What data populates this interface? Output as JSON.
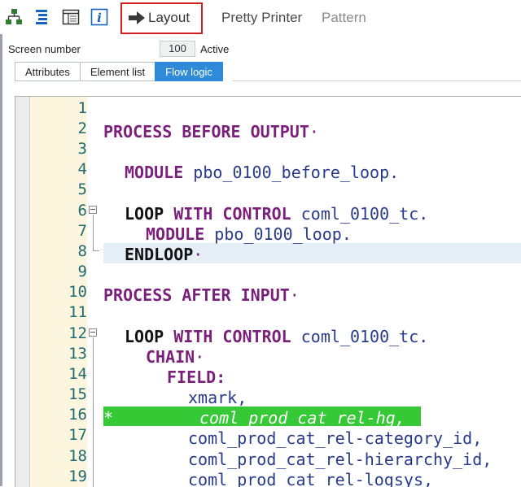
{
  "toolbar": {
    "icons": [
      {
        "name": "hierarchy-icon",
        "color": "#2e7d32"
      },
      {
        "name": "outline-icon",
        "color": "#1565c0"
      },
      {
        "name": "display-list-icon",
        "color": "#333333"
      },
      {
        "name": "info-icon",
        "color": "#1565c0"
      }
    ],
    "layout_label": "Layout",
    "pretty_printer_label": "Pretty Printer",
    "pattern_label": "Pattern"
  },
  "screen": {
    "label": "Screen number",
    "number": "100",
    "status": "Active"
  },
  "tabs": [
    {
      "label": "Attributes",
      "active": false
    },
    {
      "label": "Element list",
      "active": false
    },
    {
      "label": "Flow logic",
      "active": true
    }
  ],
  "editor": {
    "line_numbers": [
      "1",
      "2",
      "3",
      "4",
      "5",
      "6",
      "7",
      "8",
      "9",
      "10",
      "11",
      "12",
      "13",
      "14",
      "15",
      "16",
      "17",
      "18",
      "19"
    ],
    "lines": {
      "l2_kw": "PROCESS BEFORE OUTPUT",
      "l4_kw": "MODULE",
      "l4_id": "pbo_0100_before_loop.",
      "l6_kw1": "LOOP",
      "l6_kw2": "WITH CONTROL",
      "l6_id": "coml_0100_tc.",
      "l7_kw": "MODULE",
      "l7_id": "pbo_0100_loop.",
      "l8_kw": "ENDLOOP",
      "l10_kw": "PROCESS AFTER INPUT",
      "l12_kw1": "LOOP",
      "l12_kw2": "WITH CONTROL",
      "l12_id": "coml_0100_tc.",
      "l13_kw": "CHAIN",
      "l14_kw": "FIELD:",
      "l15_id": "xmark,",
      "l16_star": "*",
      "l16_text": "coml_prod_cat_rel-hg,",
      "l17_id": "coml_prod_cat_rel-category_id,",
      "l18_id": "coml_prod_cat_rel-hierarchy_id,",
      "l19_id": "coml_prod_cat_rel-logsys,"
    },
    "colors": {
      "keyword": "#7a1f7a",
      "identifier": "#283b8a",
      "gutter": "#fdf6df",
      "highlight": "#35c935",
      "line_number": "#1f6a72"
    }
  }
}
